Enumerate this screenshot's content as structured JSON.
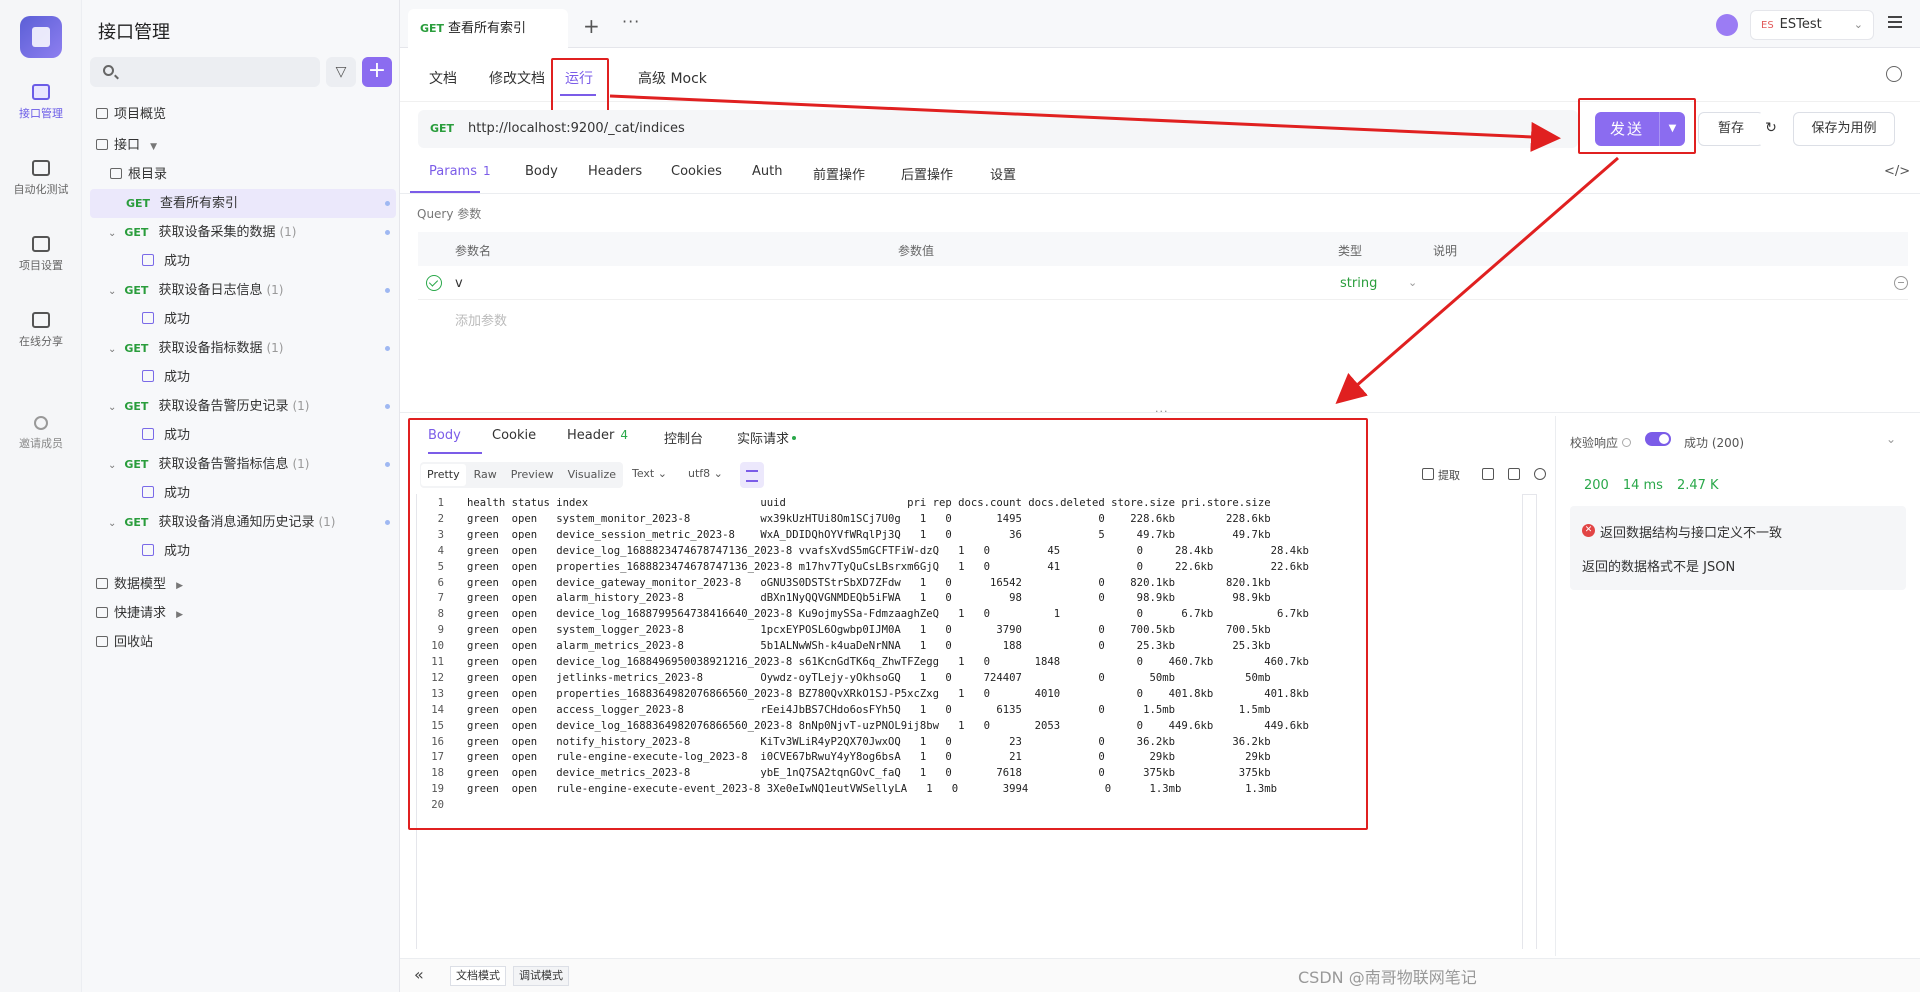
{
  "rail": {
    "items": [
      {
        "label": "接口管理"
      },
      {
        "label": "自动化测试"
      },
      {
        "label": "项目设置"
      },
      {
        "label": "在线分享"
      },
      {
        "label": "邀请成员"
      }
    ]
  },
  "sidebar": {
    "title": "接口管理",
    "search_placeholder": "",
    "add_label": "+",
    "overview": "项目概览",
    "api_group": "接口",
    "root": "根目录",
    "items": [
      {
        "method": "GET",
        "name": "查看所有索引",
        "count": ""
      },
      {
        "method": "GET",
        "name": "获取设备采集的数据",
        "count": "(1)"
      },
      {
        "method": "",
        "name": "成功",
        "count": ""
      },
      {
        "method": "GET",
        "name": "获取设备日志信息",
        "count": "(1)"
      },
      {
        "method": "",
        "name": "成功",
        "count": ""
      },
      {
        "method": "GET",
        "name": "获取设备指标数据",
        "count": "(1)"
      },
      {
        "method": "",
        "name": "成功",
        "count": ""
      },
      {
        "method": "GET",
        "name": "获取设备告警历史记录",
        "count": "(1)"
      },
      {
        "method": "",
        "name": "成功",
        "count": ""
      },
      {
        "method": "GET",
        "name": "获取设备告警指标信息",
        "count": "(1)"
      },
      {
        "method": "",
        "name": "成功",
        "count": ""
      },
      {
        "method": "GET",
        "name": "获取设备消息通知历史记录",
        "count": "(1)"
      },
      {
        "method": "",
        "name": "成功",
        "count": ""
      }
    ],
    "data_models": "数据模型",
    "quick_requests": "快捷请求",
    "recycle_bin": "回收站"
  },
  "tabs": {
    "current_method": "GET",
    "current_title": "查看所有索引",
    "plus": "+",
    "more": "···"
  },
  "env": {
    "tag": "ES",
    "name": "ESTest"
  },
  "op_tabs": [
    "文档",
    "修改文档",
    "运行",
    "高级 Mock"
  ],
  "request": {
    "method": "GET",
    "url": "http://localhost:9200/_cat/indices",
    "send_label": "发送",
    "save_temp_label": "暂存",
    "save_case_label": "保存为用例"
  },
  "req_tabs": [
    {
      "label": "Params",
      "count": "1"
    },
    {
      "label": "Body",
      "count": ""
    },
    {
      "label": "Headers",
      "count": ""
    },
    {
      "label": "Cookies",
      "count": ""
    },
    {
      "label": "Auth",
      "count": ""
    },
    {
      "label": "前置操作",
      "count": ""
    },
    {
      "label": "后置操作",
      "count": ""
    },
    {
      "label": "设置",
      "count": ""
    }
  ],
  "query": {
    "section_label": "Query 参数",
    "headers": [
      "参数名",
      "参数值",
      "类型",
      "说明"
    ],
    "rows": [
      {
        "name": "v",
        "value": "",
        "type": "string",
        "desc": ""
      }
    ],
    "add_label": "添加参数"
  },
  "response": {
    "tabs": [
      {
        "label": "Body",
        "count": ""
      },
      {
        "label": "Cookie",
        "count": ""
      },
      {
        "label": "Header",
        "count": "4"
      },
      {
        "label": "控制台",
        "count": ""
      },
      {
        "label": "实际请求",
        "count": ""
      }
    ],
    "formats": [
      "Pretty",
      "Raw",
      "Preview",
      "Visualize"
    ],
    "text_mode": "Text",
    "encoding": "utf8",
    "extract_label": "提取",
    "lines": [
      "health status index                           uuid                   pri rep docs.count docs.deleted store.size pri.store.size",
      "green  open   system_monitor_2023-8           wx39kUzHTUi8Om1SCj7U0g   1   0       1495            0    228.6kb        228.6kb",
      "green  open   device_session_metric_2023-8    WxA_DDIDQhOYVfWRqlPj3Q   1   0         36            5     49.7kb         49.7kb",
      "green  open   device_log_1688823474678747136_2023-8 vvafsXvdS5mGCFTFiW-dzQ   1   0         45            0     28.4kb         28.4kb",
      "green  open   properties_1688823474678747136_2023-8 m17hv7TyQuCsLBsrxm6GjQ   1   0         41            0     22.6kb         22.6kb",
      "green  open   device_gateway_monitor_2023-8   oGNU3S0DSTStrSbXD7ZFdw   1   0      16542            0    820.1kb        820.1kb",
      "green  open   alarm_history_2023-8            dBXn1NyQQVGNMDEQb5iFWA   1   0         98            0     98.9kb         98.9kb",
      "green  open   device_log_1688799564738416640_2023-8 Ku9ojmySSa-FdmzaaghZeQ   1   0          1            0      6.7kb          6.7kb",
      "green  open   system_logger_2023-8            1pcxEYPOSL6Ogwbp0IJM0A   1   0       3790            0    700.5kb        700.5kb",
      "green  open   alarm_metrics_2023-8            5b1ALNwWSh-k4uaDeNrNNA   1   0        188            0     25.3kb         25.3kb",
      "green  open   device_log_1688496950038921216_2023-8 s61KcnGdTK6q_ZhwTFZegg   1   0       1848            0    460.7kb        460.7kb",
      "green  open   jetlinks-metrics_2023-8         Oywdz-oyTLejy-yOkhsoGQ   1   0     724407            0       50mb           50mb",
      "green  open   properties_1688364982076866560_2023-8 BZ780QvXRkO1SJ-P5xcZxg   1   0       4010            0    401.8kb        401.8kb",
      "green  open   access_logger_2023-8            rEei4JbBS7CHdo6osFYh5Q   1   0       6135            0      1.5mb          1.5mb",
      "green  open   device_log_1688364982076866560_2023-8 8nNp0NjvT-uzPNOL9ij8bw   1   0       2053            0    449.6kb        449.6kb",
      "green  open   notify_history_2023-8           KiTv3WLiR4yP2QX70JwxOQ   1   0         23            0     36.2kb         36.2kb",
      "green  open   rule-engine-execute-log_2023-8  i0CVE67bRwuY4yY8og6bsA   1   0         21            0       29kb           29kb",
      "green  open   device_metrics_2023-8           ybE_1nQ7SA2tqnGOvC_faQ   1   0       7618            0      375kb          375kb",
      "green  open   rule-engine-execute-event_2023-8 3Xe0eIwNQ1eutVWSellyLA   1   0       3994            0      1.3mb          1.3mb",
      ""
    ]
  },
  "validation": {
    "label": "校验响应",
    "status_label": "成功 (200)",
    "status_code": "200",
    "time": "14 ms",
    "size": "2.47 K",
    "error_title": "返回数据结构与接口定义不一致",
    "error_message": "返回的数据格式不是 JSON"
  },
  "bottom": {
    "collapse": "«",
    "doc_mode": "文档模式",
    "debug_mode": "调试模式",
    "watermark": "CSDN @南哥物联网笔记"
  },
  "colors": {
    "accent": "#7b5ce8",
    "get_method": "#2a9d3c",
    "highlight": "#e02020"
  }
}
